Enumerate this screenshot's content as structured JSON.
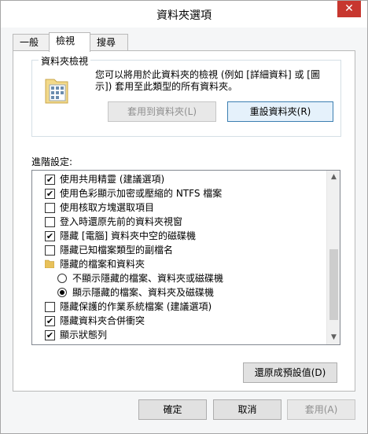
{
  "window": {
    "title": "資料夾選項",
    "close_glyph": "✕"
  },
  "tabs": [
    {
      "label": "一般"
    },
    {
      "label": "檢視"
    },
    {
      "label": "搜尋"
    }
  ],
  "folder_views": {
    "group_title": "資料夾檢視",
    "description": "您可以將用於此資料夾的檢視 (例如 [詳細資料] 或 [圖示]) 套用至此類型的所有資料夾。",
    "apply_button": "套用到資料夾(L)",
    "reset_button": "重設資料夾(R)"
  },
  "advanced": {
    "label": "進階設定:",
    "items": [
      {
        "type": "checkbox",
        "checked": true,
        "label": "使用共用精靈 (建議選項)"
      },
      {
        "type": "checkbox",
        "checked": true,
        "label": "使用色彩顯示加密或壓縮的 NTFS 檔案"
      },
      {
        "type": "checkbox",
        "checked": false,
        "label": "使用核取方塊選取項目"
      },
      {
        "type": "checkbox",
        "checked": false,
        "label": "登入時還原先前的資料夾視窗"
      },
      {
        "type": "checkbox",
        "checked": true,
        "label": "隱藏 [電腦] 資料夾中空的磁碟機"
      },
      {
        "type": "checkbox",
        "checked": false,
        "label": "隱藏已知檔案類型的副檔名"
      },
      {
        "type": "folder",
        "label": "隱藏的檔案和資料夾"
      },
      {
        "type": "radio",
        "checked": false,
        "label": "不顯示隱藏的檔案、資料夾或磁碟機"
      },
      {
        "type": "radio",
        "checked": true,
        "label": "顯示隱藏的檔案、資料夾及磁碟機"
      },
      {
        "type": "checkbox",
        "checked": false,
        "label": "隱藏保護的作業系統檔案 (建議選項)"
      },
      {
        "type": "checkbox",
        "checked": true,
        "label": "隱藏資料夾合併衝突"
      },
      {
        "type": "checkbox",
        "checked": true,
        "label": "顯示狀態列"
      }
    ],
    "restore_defaults_button": "還原成預設值(D)"
  },
  "footer": {
    "ok": "確定",
    "cancel": "取消",
    "apply": "套用(A)"
  },
  "icons": {
    "check_glyph": "✔",
    "scroll_up_glyph": "▲",
    "scroll_down_glyph": "▼"
  }
}
